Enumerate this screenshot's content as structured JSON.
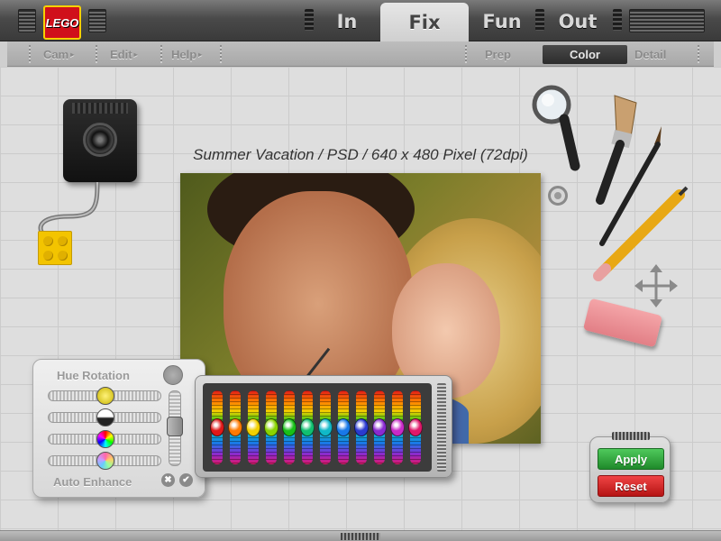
{
  "app": {
    "logo_text": "LEGO"
  },
  "main_tabs": [
    {
      "label": "In"
    },
    {
      "label": "Fix"
    },
    {
      "label": "Fun"
    },
    {
      "label": "Out"
    }
  ],
  "main_tab_active": "Fix",
  "sub_menu_left": [
    {
      "label": "Cam"
    },
    {
      "label": "Edit"
    },
    {
      "label": "Help"
    }
  ],
  "sub_tabs": [
    {
      "label": "Prep"
    },
    {
      "label": "Color"
    },
    {
      "label": "Detail"
    }
  ],
  "sub_tab_active": "Color",
  "photo": {
    "title": "Summer Vacation / PSD / 640 x 480 Pixel (72dpi)"
  },
  "tools": {
    "icons": [
      "magnifier-icon",
      "paint-brush-icon",
      "fine-brush-icon",
      "pencil-icon",
      "move-icon",
      "eraser-icon",
      "zoom-icon",
      "camera-icon"
    ]
  },
  "hue_panel": {
    "title": "Hue Rotation",
    "auto_enhance_label": "Auto Enhance",
    "cancel_symbol": "✖",
    "confirm_symbol": "✔",
    "slider_values": [
      0.5,
      0.5,
      0.5,
      0.5
    ],
    "vertical_slider_value": 0.55
  },
  "equalizer": {
    "knob_colors": [
      "#e01818",
      "#ff7a00",
      "#f2d000",
      "#8ad400",
      "#18c018",
      "#10c070",
      "#10b8c8",
      "#1878e8",
      "#2a3ad0",
      "#8a2ad0",
      "#c82ac8",
      "#e0186a"
    ],
    "knob_levels": [
      0.5,
      0.5,
      0.5,
      0.5,
      0.5,
      0.5,
      0.5,
      0.5,
      0.5,
      0.5,
      0.5,
      0.5
    ]
  },
  "actions": {
    "apply_label": "Apply",
    "reset_label": "Reset"
  },
  "colors": {
    "apply": "#2faa3c",
    "reset": "#d82020",
    "logo_red": "#d0101b",
    "logo_yellow": "#f7d000"
  }
}
